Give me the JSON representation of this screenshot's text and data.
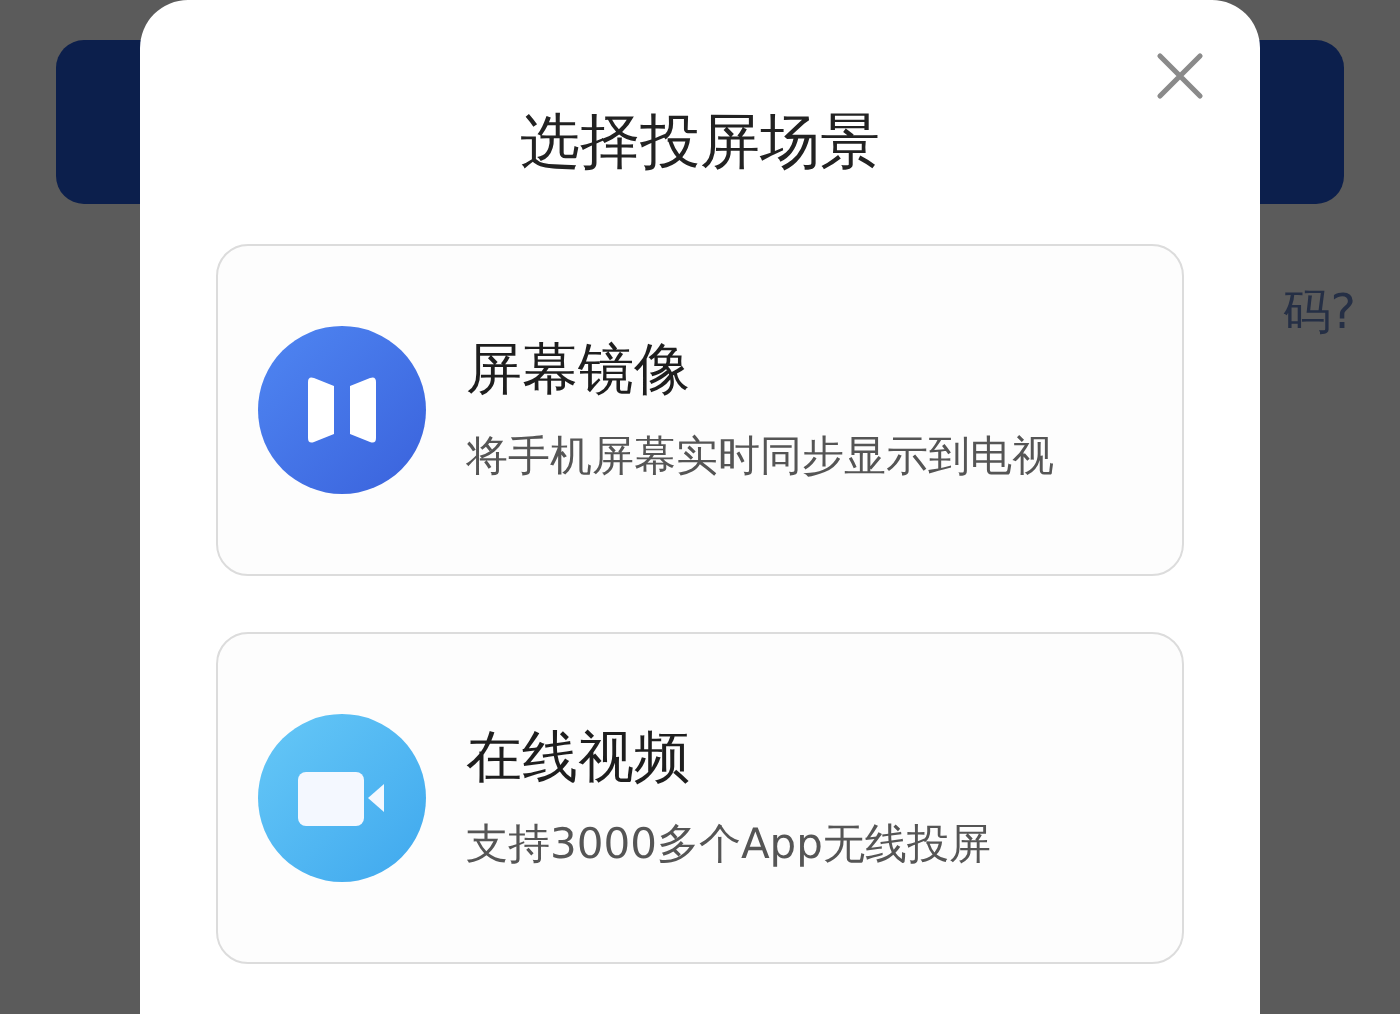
{
  "background_page": {
    "link_text": "码?"
  },
  "dialog": {
    "title": "选择投屏场景",
    "options": [
      {
        "kind": "mirror",
        "title": "屏幕镜像",
        "description": "将手机屏幕实时同步显示到电视"
      },
      {
        "kind": "video",
        "title": "在线视频",
        "description": "支持3000多个App无线投屏"
      }
    ]
  }
}
